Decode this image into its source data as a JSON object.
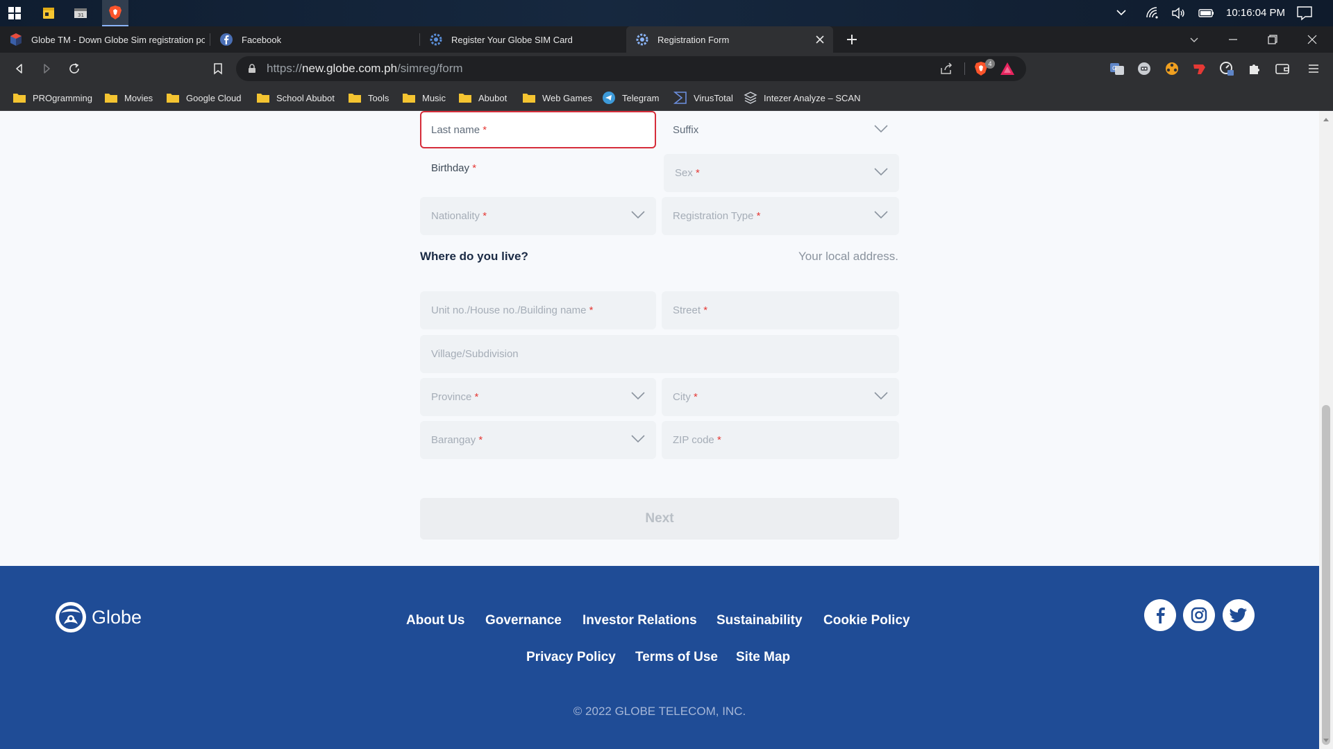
{
  "taskbar": {
    "clock": "10:16:04 PM",
    "icons": [
      "windows-start-icon",
      "sticky-notes-icon",
      "calendar-app-icon",
      "brave-browser-icon"
    ]
  },
  "browser": {
    "tabs": [
      {
        "title": "Globe TM - Down Globe Sim registration port",
        "icon": "globe-favicon"
      },
      {
        "title": "Facebook",
        "icon": "facebook-favicon"
      },
      {
        "title": "Register Your Globe SIM Card",
        "icon": "gear-favicon"
      },
      {
        "title": "Registration Form",
        "icon": "gear-favicon",
        "active": true
      }
    ],
    "url_scheme": "https://",
    "url_host": "new.globe.com.ph",
    "url_path": "/simreg/form",
    "bookmarks": [
      {
        "label": "PROgramming",
        "icon": "folder-icon"
      },
      {
        "label": "Movies",
        "icon": "folder-icon"
      },
      {
        "label": "Google Cloud",
        "icon": "folder-icon"
      },
      {
        "label": "School Abubot",
        "icon": "folder-icon"
      },
      {
        "label": "Tools",
        "icon": "folder-icon"
      },
      {
        "label": "Music",
        "icon": "folder-icon"
      },
      {
        "label": "Abubot",
        "icon": "folder-icon"
      },
      {
        "label": "Web Games",
        "icon": "folder-icon"
      },
      {
        "label": "Telegram",
        "icon": "telegram-icon"
      },
      {
        "label": "VirusTotal",
        "icon": "virustotal-icon"
      },
      {
        "label": "Intezer Analyze – SCAN",
        "icon": "intezer-icon"
      }
    ],
    "shield_badge": "4"
  },
  "form": {
    "last_name": {
      "label": "Last name",
      "required": "*"
    },
    "suffix": {
      "label": "Suffix"
    },
    "birthday": {
      "label": "Birthday",
      "required": "*"
    },
    "sex": {
      "label": "Sex",
      "required": "*"
    },
    "nationality": {
      "label": "Nationality",
      "required": "*"
    },
    "registration_type": {
      "label": "Registration Type",
      "required": "*"
    },
    "address_title": "Where do you live?",
    "address_note": "Your local address.",
    "unit": {
      "label": "Unit no./House no./Building name",
      "required": "*"
    },
    "street": {
      "label": "Street",
      "required": "*"
    },
    "village": {
      "label": "Village/Subdivision"
    },
    "province": {
      "label": "Province",
      "required": "*"
    },
    "city": {
      "label": "City",
      "required": "*"
    },
    "barangay": {
      "label": "Barangay",
      "required": "*"
    },
    "zip": {
      "label": "ZIP code",
      "required": "*"
    },
    "next_label": "Next"
  },
  "footer": {
    "brand": "Globe",
    "links_row1": [
      "About Us",
      "Governance",
      "Investor Relations",
      "Sustainability",
      "Cookie Policy"
    ],
    "links_row2": [
      "Privacy Policy",
      "Terms of Use",
      "Site Map"
    ],
    "social": [
      "facebook-icon",
      "instagram-icon",
      "twitter-icon"
    ],
    "copyright": "© 2022 GLOBE TELECOM, INC."
  }
}
